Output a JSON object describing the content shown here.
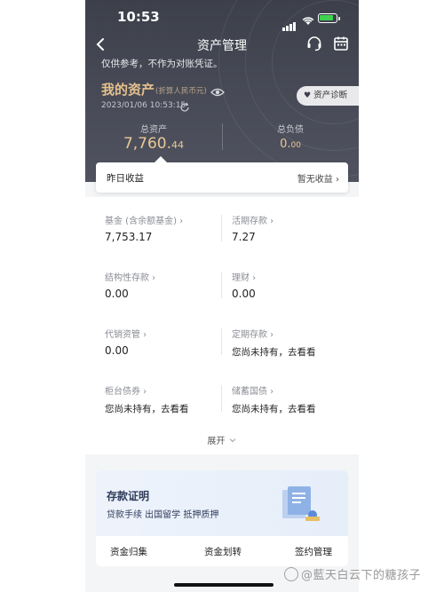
{
  "status": {
    "time": "10:53"
  },
  "nav": {
    "title": "资产管理",
    "back_icon": "chevron-left-icon",
    "icons": [
      "headset-icon",
      "calendar-icon"
    ]
  },
  "hero": {
    "disclaimer": "仅供参考，不作为对账凭证。",
    "my_assets": "我的资产",
    "currency_note": "(折算人民币元)",
    "datetime": "2023/01/06 10:53:15",
    "diagnosis_button": "资产诊断",
    "total_assets_label": "总资产",
    "total_assets_int": "7,760.",
    "total_assets_dec": "44",
    "total_debt_label": "总负债",
    "total_debt_int": "0.",
    "total_debt_dec": "00"
  },
  "yesterday": {
    "label": "昨日收益",
    "value": "暂无收益 ›"
  },
  "assets": [
    {
      "label": "基金 (含余额基金) ›",
      "value": "7,753.17"
    },
    {
      "label": "活期存款 ›",
      "value": "7.27"
    },
    {
      "label": "结构性存款 ›",
      "value": "0.00"
    },
    {
      "label": "理财 ›",
      "value": "0.00"
    },
    {
      "label": "代销资管 ›",
      "value": "0.00"
    },
    {
      "label": "定期存款 ›",
      "value": "您尚未持有，去看看"
    },
    {
      "label": "柜台债券 ›",
      "value": "您尚未持有，去看看"
    },
    {
      "label": "储蓄国债 ›",
      "value": "您尚未持有，去看看"
    }
  ],
  "expand": "展开",
  "proof": {
    "title": "存款证明",
    "subtitle": "贷款手续 出国留学 抵押质押",
    "buttons": [
      "资金归集",
      "资金划转",
      "签约管理"
    ]
  },
  "watermark": "@藍天白云下的糖孩子",
  "colors": {
    "hero_bg": "#454853",
    "gold": "#e9c896",
    "label_gray": "#8a8d94"
  }
}
